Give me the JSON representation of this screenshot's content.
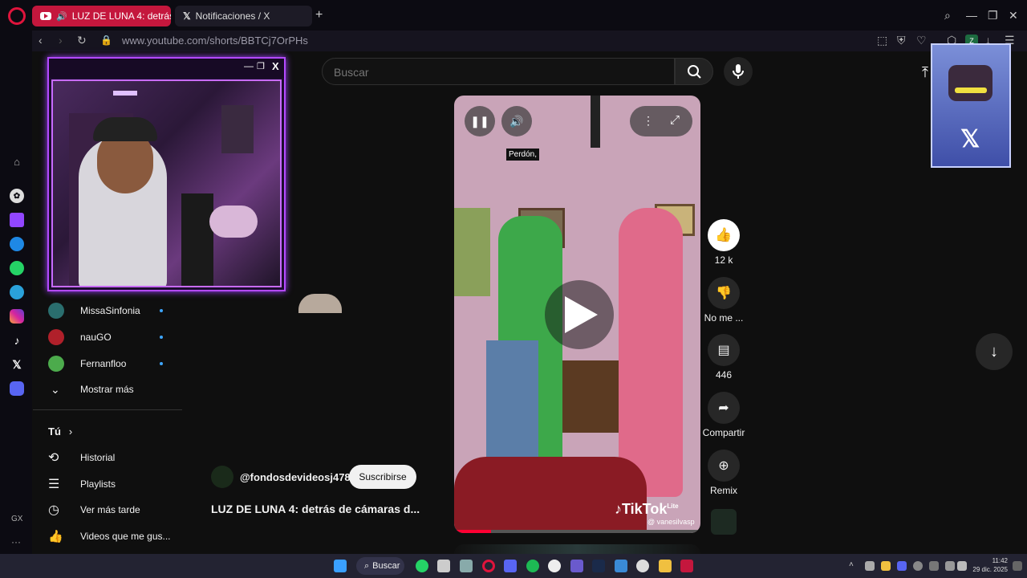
{
  "browser": {
    "tabs": [
      {
        "title": "LUZ DE LUNA 4: detrás"
      },
      {
        "title": "Notificaciones / X"
      }
    ],
    "url": "www.youtube.com/shorts/BBTCj7OrPHs",
    "profile_badge": "Z"
  },
  "opera_sidebar": {
    "bottom_label": "GX",
    "more": "···"
  },
  "youtube": {
    "search": {
      "placeholder": "Buscar"
    },
    "subscriptions": [
      {
        "name": "MissaSinfonia",
        "avatar_color": "#2a6e6e"
      },
      {
        "name": "nauGO",
        "avatar_color": "#b0202a"
      },
      {
        "name": "Fernanfloo",
        "avatar_color": "#4cab4c"
      }
    ],
    "show_more": "Mostrar más",
    "you_section": {
      "title": "Tú",
      "items": [
        {
          "label": "Historial",
          "icon": "history-icon"
        },
        {
          "label": "Playlists",
          "icon": "playlist-icon"
        },
        {
          "label": "Ver más tarde",
          "icon": "clock-icon"
        },
        {
          "label": "Videos que me gus...",
          "icon": "thumbs-up-icon"
        }
      ]
    },
    "short": {
      "channel": "@fondosdevideosj478",
      "subscribe": "Suscribirse",
      "title": "LUZ DE LUNA 4: detrás de cámaras d...",
      "caption": "Perdón,",
      "watermark": "TikTok",
      "watermark_sup": "Lite",
      "watermark_user": "@ vanesilvasp",
      "progress": 0.15
    },
    "actions": [
      {
        "label": "12 k",
        "icon": "like-icon"
      },
      {
        "label": "No me ...",
        "icon": "dislike-icon"
      },
      {
        "label": "446",
        "icon": "comment-icon"
      },
      {
        "label": "Compartir",
        "icon": "share-icon"
      },
      {
        "label": "Remix",
        "icon": "remix-icon"
      }
    ]
  },
  "taskbar": {
    "search": "Buscar",
    "time": "11:42",
    "date": "29 dic. 2025"
  },
  "colors": {
    "accent": "#c4173d",
    "webcam_border": "#b44aff",
    "progress": "#ff0033"
  }
}
